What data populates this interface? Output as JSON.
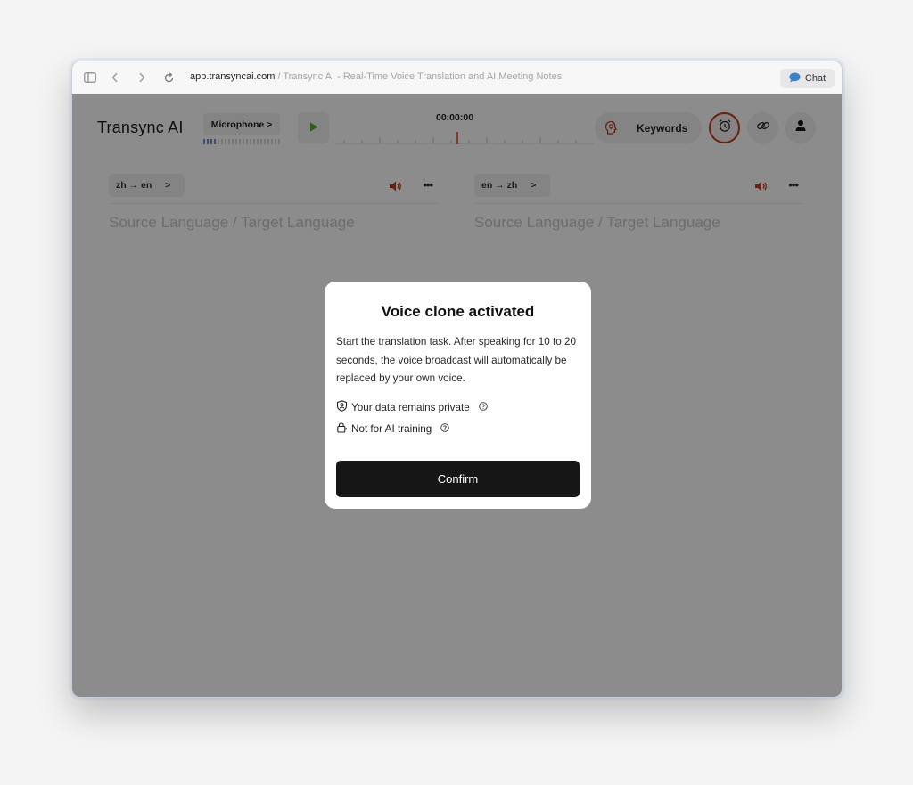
{
  "browser": {
    "url_domain": "app.transyncai.com",
    "url_separator": " / ",
    "page_title": "Transync AI - Real-Time Voice Translation and AI Meeting Notes",
    "chat_label": "Chat"
  },
  "header": {
    "app_title": "Transync AI",
    "microphone_label": "Microphone >",
    "timer": "00:00:00",
    "keywords_label": "Keywords"
  },
  "panels": [
    {
      "direction_label": "zh → en",
      "chevron": ">",
      "more": "•••",
      "placeholder": "Source Language / Target Language"
    },
    {
      "direction_label": "en → zh",
      "chevron": ">",
      "more": "•••",
      "placeholder": "Source Language / Target Language"
    }
  ],
  "modal": {
    "title": "Voice clone activated",
    "body": "Start the translation task. After speaking for 10 to 20 seconds, the voice broadcast will automatically be replaced by your own voice.",
    "feature_private": "Your data remains private",
    "feature_training": "Not for AI training",
    "confirm_label": "Confirm"
  },
  "colors": {
    "accent_red": "#c43a1b",
    "play_green": "#5aa832",
    "confirm_bg": "#161616"
  },
  "icons": {
    "sidebar": "sidebar-icon",
    "back": "chevron-left-icon",
    "forward": "chevron-right-icon",
    "reload": "reload-icon",
    "chat": "chat-bubble-icon",
    "play": "play-icon",
    "keywords": "head-bulb-icon",
    "alarm": "alarm-clock-icon",
    "link": "link-icon",
    "user": "user-icon",
    "speaker": "speaker-icon",
    "shield": "shield-user-icon",
    "lock": "lock-icon",
    "help": "help-circle-icon"
  }
}
